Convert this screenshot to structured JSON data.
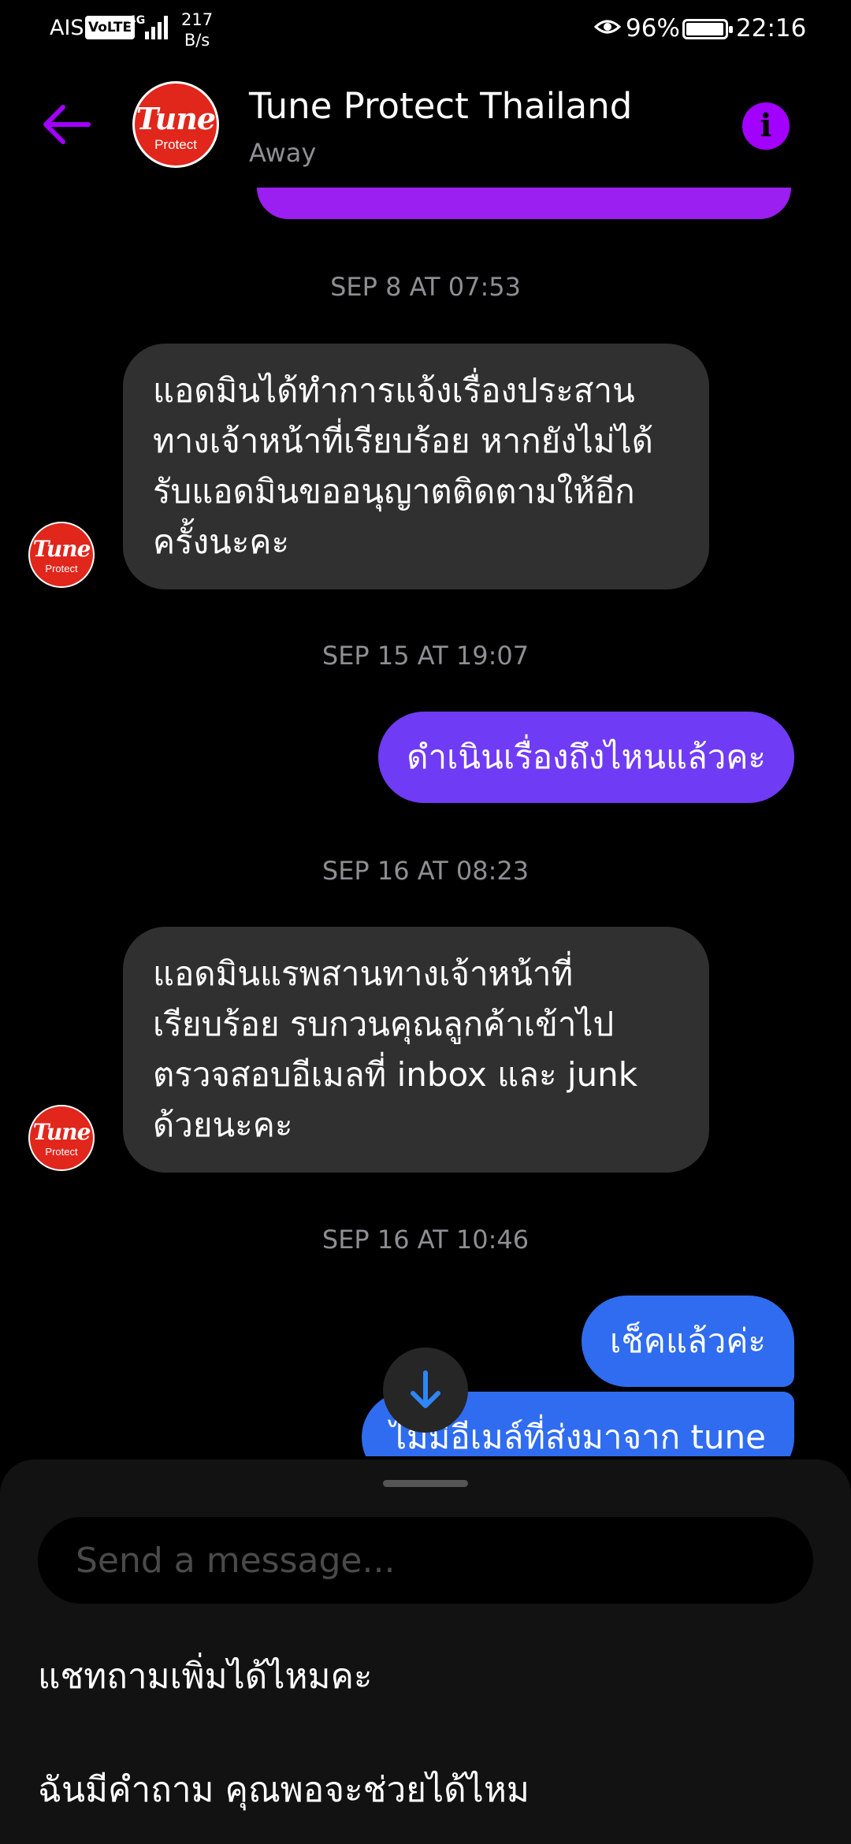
{
  "status_bar": {
    "carrier": "AIS",
    "volte": "VoLTE",
    "network": "4G",
    "speed_value": "217",
    "speed_unit": "B/s",
    "battery": "96%",
    "battery_level": 0.96,
    "time": "22:16",
    "icons": [
      "signal-icon",
      "eye-icon",
      "battery-icon"
    ]
  },
  "header": {
    "contact_name": "Tune Protect Thailand",
    "status": "Away",
    "logo_word": "Tune",
    "logo_sub": "Protect",
    "back_icon": "arrow-left-icon",
    "info_icon": "info-icon",
    "info_glyph": "i"
  },
  "colors": {
    "accent": "#a200ff",
    "outgoing_purple": "#6f3bf5",
    "outgoing_blue": "#2f6cf0",
    "incoming": "#303030",
    "logo_red": "#e1261c"
  },
  "chat": {
    "timestamps": [
      "SEP 8 AT 07:53",
      "SEP 15 AT 19:07",
      "SEP 16 AT 08:23",
      "SEP 16 AT 10:46"
    ],
    "messages": [
      {
        "direction": "in",
        "text": "แอดมินได้ทำการแจ้งเรื่องประสาน ทางเจ้าหน้าที่เรียบร้อย หากยังไม่ได้รับแอดมินขออนุญาตติดตามให้อีกครั้งนะคะ"
      },
      {
        "direction": "out",
        "text": "ดำเนินเรื่องถึงไหนแล้วคะ"
      },
      {
        "direction": "in",
        "text": "แอดมินแรพสานทางเจ้าหน้าที่ เรียบร้อย รบกวนคุณลูกค้าเข้าไปตรวจสอบอีเมลที่ inbox และ junk ด้วยนะคะ"
      },
      {
        "direction": "out",
        "text": "เช็คแล้วค่ะ"
      },
      {
        "direction": "out",
        "text": "ไม่มีอีเมล์ที่ส่งมาจาก tune"
      }
    ],
    "scroll_icon": "arrow-down-icon"
  },
  "composer": {
    "placeholder": "Send a message..."
  },
  "suggestions": [
    "แชทถามเพิ่มได้ไหมคะ",
    "ฉันมีคำถาม คุณพอจะช่วยได้ไหม"
  ]
}
